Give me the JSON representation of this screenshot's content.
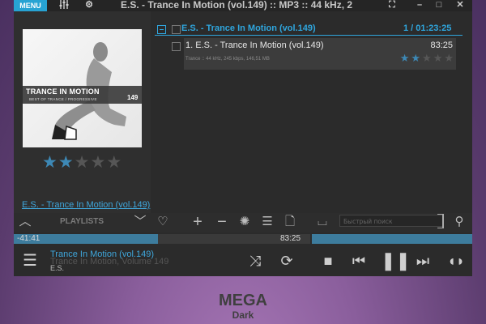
{
  "titlebar": {
    "menu_label": "MENU",
    "title": "E.S. - Trance In Motion (vol.149) :: MP3 :: 44 kHz, 2"
  },
  "cover": {
    "title": "TRANCE IN MOTION",
    "subtitle": "BEST OF TRANCE / PROGRESSIVE",
    "number": "149"
  },
  "left_panel": {
    "rating": 2,
    "max_rating": 5,
    "link_text": "E.S. - Trance In Motion (vol.149)"
  },
  "playlist": {
    "group_title": "E.S. - Trance In Motion (vol.149)",
    "group_count": "1 / 01:23:25",
    "tracks": [
      {
        "title": "1. E.S. - Trance In Motion (vol.149)",
        "duration": "83:25",
        "meta": "Trance :: 44 kHz, 245 kbps, 146,51 MB",
        "rating": 2
      }
    ]
  },
  "controls": {
    "playlists_label": "PLAYLISTS",
    "search_placeholder": "Быстрый поиск"
  },
  "progress": {
    "elapsed": "-41:41",
    "total": "83:25",
    "fraction": 0.5,
    "volume_fraction": 1.0
  },
  "now_playing": {
    "title": "Trance In Motion (vol.149)",
    "subtitle": "Trance In Motion, Volume 149",
    "artist": "E.S."
  },
  "brand": {
    "line1": "MEGA",
    "line2": "Dark"
  },
  "colors": {
    "accent": "#2fa6de",
    "progress": "#3d7c9d",
    "background_top": "#5a3b6d",
    "background_bottom": "#a777b6"
  }
}
